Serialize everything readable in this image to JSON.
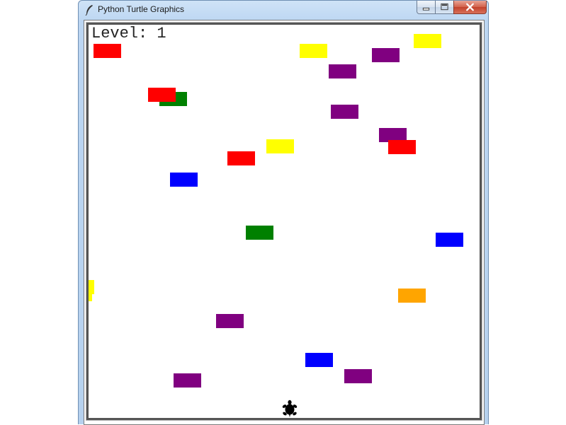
{
  "window": {
    "title": "Python Turtle Graphics",
    "title_icon": "feather-quill-icon",
    "controls": [
      "minimize-icon",
      "maximize-icon",
      "close-icon"
    ]
  },
  "game": {
    "level_text": "Level: 1",
    "background": "#ffffff",
    "player_icon": "turtle-icon",
    "player_color": "#000000",
    "car_colors": {
      "red": "#ff0000",
      "yellow": "#ffff00",
      "purple": "#800080",
      "green": "#008000",
      "blue": "#0000ff",
      "orange": "#ffa500"
    },
    "car_count": 23
  }
}
